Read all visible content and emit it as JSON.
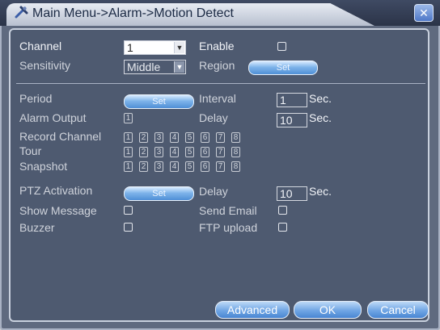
{
  "title": "Main Menu->Alarm->Motion Detect",
  "close_symbol": "✕",
  "fields": {
    "channel_label": "Channel",
    "channel_value": "1",
    "enable_label": "Enable",
    "sensitivity_label": "Sensitivity",
    "sensitivity_value": "Middle",
    "region_label": "Region",
    "set_label": "Set",
    "period_label": "Period",
    "interval_label": "Interval",
    "interval_value": "1",
    "sec": "Sec.",
    "alarm_output_label": "Alarm Output",
    "alarm_output_number": "1",
    "delay_label": "Delay",
    "delay_value_1": "10",
    "record_channel_label": "Record Channel",
    "tour_label": "Tour",
    "snapshot_label": "Snapshot",
    "ptz_activation_label": "PTZ Activation",
    "delay_value_2": "10",
    "show_message_label": "Show Message",
    "send_email_label": "Send Email",
    "buzzer_label": "Buzzer",
    "ftp_upload_label": "FTP upload",
    "channel_numbers": [
      "1",
      "2",
      "3",
      "4",
      "5",
      "6",
      "7",
      "8"
    ]
  },
  "buttons": {
    "advanced": "Advanced",
    "ok": "OK",
    "cancel": "Cancel"
  },
  "icons": {
    "title_icon": "tools-icon",
    "close_icon": "close-icon"
  }
}
